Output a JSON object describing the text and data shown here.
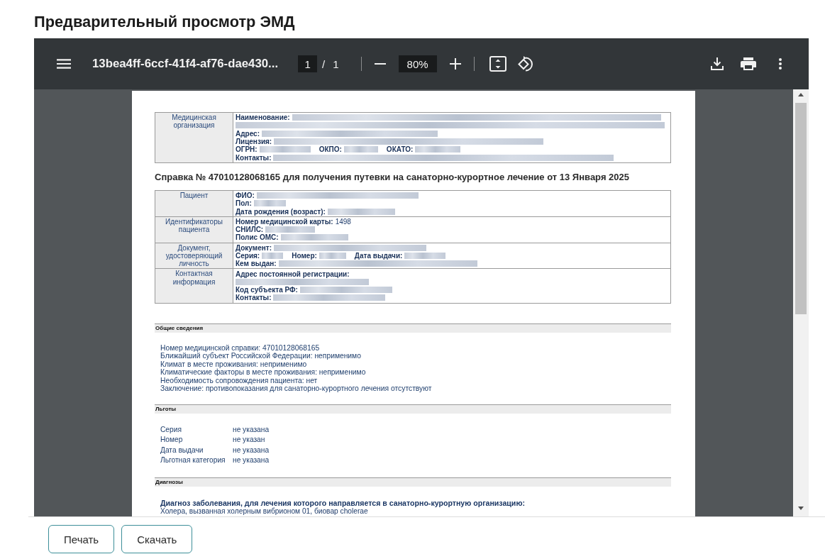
{
  "title": "Предварительный просмотр ЭМД",
  "viewer": {
    "file_name": "13bea4ff-6ccf-41f4-af76-dae430...",
    "page_input": "1",
    "page_separator": "/",
    "page_count": "1",
    "zoom": "80%"
  },
  "document": {
    "org_table": {
      "rows": [
        {
          "heading": "Медицинская организация",
          "lines": [
            [
              {
                "label": "Наименование:",
                "masked": true
              }
            ],
            [
              {
                "masked": true
              }
            ],
            [
              {
                "label": "Адрес:",
                "masked": true
              }
            ],
            [
              {
                "label": "Лицензия:",
                "masked": true
              }
            ],
            [
              {
                "label": "ОГРН:",
                "masked": true
              },
              {
                "label": "ОКПО:",
                "masked": true
              },
              {
                "label": "ОКАТО:",
                "masked": true
              }
            ],
            [
              {
                "label": "Контакты:",
                "masked": true
              }
            ]
          ]
        }
      ]
    },
    "heading": "Справка № 47010128068165 для получения путевки на санаторно-курортное лечение от 13 Января 2025",
    "patient_table": {
      "rows": [
        {
          "heading": "Пациент",
          "lines": [
            [
              {
                "label": "ФИО:",
                "masked": true
              }
            ],
            [
              {
                "label": "Пол:",
                "masked": true
              }
            ],
            [
              {
                "label": "Дата рождения (возраст):",
                "masked": true
              }
            ]
          ]
        },
        {
          "heading": "Идентификаторы пациента",
          "lines": [
            [
              {
                "label": "Номер медицинской карты:",
                "value": "1498",
                "masked": false
              }
            ],
            [
              {
                "label": "СНИЛС:",
                "masked": true
              }
            ],
            [
              {
                "label": "Полис ОМС:",
                "masked": true
              }
            ]
          ]
        },
        {
          "heading": "Документ, удостоверяющий личность",
          "lines": [
            [
              {
                "label": "Документ:",
                "masked": true
              }
            ],
            [
              {
                "label": "Серия:",
                "masked": true
              },
              {
                "label": "Номер:",
                "masked": true
              },
              {
                "label": "Дата выдачи:",
                "masked": true
              }
            ],
            [
              {
                "label": "Кем выдан:",
                "masked": true
              }
            ]
          ]
        },
        {
          "heading": "Контактная информация",
          "lines": [
            [
              {
                "label": "Адрес постоянной регистрации:",
                "masked": false
              }
            ],
            [
              {
                "masked": true
              }
            ],
            [
              {
                "label": "Код субъекта РФ:",
                "masked": true
              }
            ],
            [
              {
                "label": "Контакты:",
                "masked": true
              }
            ]
          ]
        }
      ]
    },
    "sections": [
      {
        "kind": "lines",
        "title": "Общие сведения",
        "lines": [
          "Номер медицинской справки: 47010128068165",
          "Ближайший субъект Российской Федерации: неприменимо",
          "Климат в месте проживания: неприменимо",
          "Климатические факторы в месте проживания: неприменимо",
          "Необходимость сопровождения пациента: нет",
          "Заключение: противопоказания для санаторно-курортного лечения отсутствуют"
        ]
      },
      {
        "kind": "pairs",
        "title": "Льготы",
        "pairs": [
          {
            "label": "Серия",
            "value": "не указана"
          },
          {
            "label": "Номер",
            "value": "не указан"
          },
          {
            "label": "Дата выдачи",
            "value": "не указана"
          },
          {
            "label": "Льготная категория",
            "value": "не указана"
          }
        ]
      },
      {
        "kind": "diagnosis",
        "title": "Диагнозы",
        "heading": "Диагноз заболевания, для лечения которого направляется в санаторно-курортную организацию:",
        "lines": [
          "Холера, вызванная холерным вибрионом 01, биовар cholerae"
        ]
      }
    ]
  },
  "buttons": [
    "Печать",
    "Скачать"
  ]
}
